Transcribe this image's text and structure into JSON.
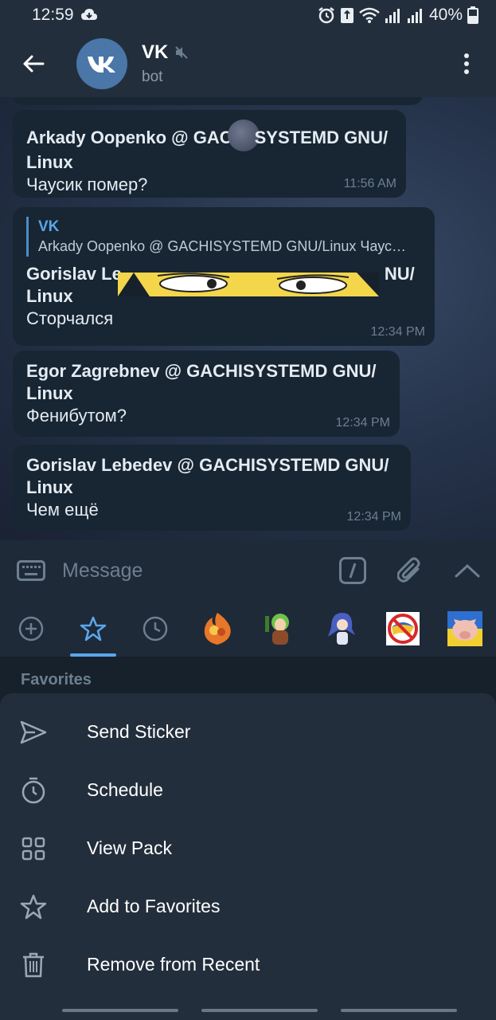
{
  "status_bar": {
    "time": "12:59",
    "battery": "40%"
  },
  "header": {
    "title": "VK",
    "subtitle": "bot"
  },
  "messages": [
    {
      "sender_lines": [
        "Arkady Oopenko @ GAC",
        "SYSTEMD GNU/",
        "Linux"
      ],
      "sender_prefix": "Arkady Oopenko @ GAC",
      "sender_suffix": "SYSTEMD GNU/",
      "sender_line2": "Linux",
      "text": "Чаусик помер?",
      "time": "11:56 AM"
    },
    {
      "reply_name": "VK",
      "reply_text": "Arkady Oopenko @ GACHISYSTEMD GNU/Linux Чаусик помер?",
      "sender_prefix": "Gorislav Le",
      "sender_suffix": "NU/",
      "sender_line2": "Linux",
      "text": "Сторчался",
      "time": "12:34 PM"
    },
    {
      "sender": "Egor Zagrebnev @ GACHISYSTEMD GNU/",
      "sender_line2": "Linux",
      "text": "Фенибутом?",
      "time": "12:34 PM"
    },
    {
      "sender": "Gorislav Lebedev @ GACHISYSTEMD GNU/",
      "sender_line2": "Linux",
      "text": "Чем ещё",
      "time": "12:34 PM"
    }
  ],
  "input": {
    "placeholder": "Message"
  },
  "sticker_tabs": [
    {
      "name": "add-icon"
    },
    {
      "name": "star-icon",
      "active": true
    },
    {
      "name": "clock-icon"
    },
    {
      "name": "sticker-fire"
    },
    {
      "name": "sticker-girl-green"
    },
    {
      "name": "sticker-girl-blue"
    },
    {
      "name": "sticker-no-sign"
    },
    {
      "name": "sticker-pig"
    }
  ],
  "favorites": {
    "title": "Favorites"
  },
  "context_menu": [
    {
      "label": "Send Sticker",
      "icon": "send-icon"
    },
    {
      "label": "Schedule",
      "icon": "timer-icon"
    },
    {
      "label": "View Pack",
      "icon": "grid-icon"
    },
    {
      "label": "Add to Favorites",
      "icon": "star-outline-icon"
    },
    {
      "label": "Remove from Recent",
      "icon": "trash-icon"
    }
  ],
  "colors": {
    "accent": "#5aa7ec",
    "background": "#17212b",
    "header": "#232e3c",
    "bubble": "#182533"
  }
}
